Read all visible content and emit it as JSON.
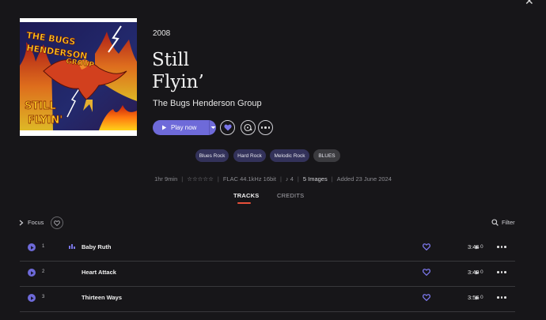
{
  "album": {
    "year": "2008",
    "title_line1": "Still",
    "title_line2": "Flyin’",
    "artist": "The Bugs Henderson Group"
  },
  "actions": {
    "play_label": "Play now"
  },
  "genres": [
    "Blues Rock",
    "Hard Rock",
    "Melodic Rock",
    "BLUES"
  ],
  "meta": {
    "duration": "1hr 9min",
    "rating_stars": "☆☆☆☆☆",
    "format": "FLAC 44.1kHz 16bit",
    "dynamic_range_icon": "♪",
    "dynamic_range": "4",
    "images": "5 Images",
    "added": "Added 23 June 2024",
    "separator": "|"
  },
  "tabs": {
    "tracks": "TRACKS",
    "credits": "CREDITS"
  },
  "toolbar": {
    "focus_label": "Focus",
    "filter_label": "Filter"
  },
  "tracks": [
    {
      "number": "1",
      "title": "Baby Ruth",
      "duration": "3:46",
      "plays": "0",
      "playing": true
    },
    {
      "number": "2",
      "title": "Heart Attack",
      "duration": "3:49",
      "plays": "0",
      "playing": false
    },
    {
      "number": "3",
      "title": "Thirteen Ways",
      "duration": "3:56",
      "plays": "0",
      "playing": false
    }
  ],
  "colors": {
    "accent": "#6e6ad9",
    "background": "#171619",
    "tab_underline": "#e8503a",
    "tag_bg": "#33325a"
  }
}
